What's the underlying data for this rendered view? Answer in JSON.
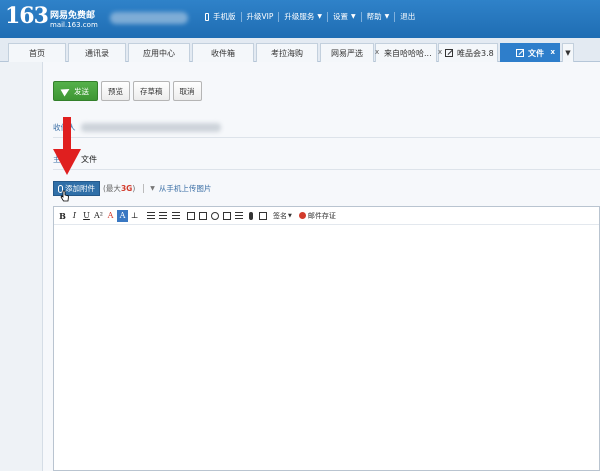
{
  "header": {
    "logo_number": "163",
    "logo_name": "网易免费邮",
    "logo_domain": "mail.163.com",
    "nav": [
      {
        "label": "手机版",
        "icon": "phone-icon"
      },
      {
        "label": "升级VIP"
      },
      {
        "label": "升级服务",
        "dropdown": true
      },
      {
        "label": "设置",
        "dropdown": true
      },
      {
        "label": "帮助",
        "dropdown": true
      },
      {
        "label": "退出"
      }
    ]
  },
  "tabs": [
    {
      "label": "首页"
    },
    {
      "label": "通讯录"
    },
    {
      "label": "应用中心"
    },
    {
      "label": "收件箱"
    },
    {
      "label": "考拉海购"
    },
    {
      "label": "网易严选"
    },
    {
      "label": "来自哈哈哈...",
      "closable": true
    },
    {
      "label": "唯品会3.8",
      "closable": true
    },
    {
      "label": "文件",
      "closable": true,
      "active": true
    }
  ],
  "tab_close_glyph": "x",
  "compose": {
    "send_label": "发送",
    "preview_label": "预览",
    "draft_label": "存草稿",
    "cancel_label": "取消",
    "recipient_label": "收件人",
    "subject_label": "主",
    "subject_value": "文件",
    "add_attachment_label": "添加附件",
    "max_size_prefix": "(最大",
    "max_size_value": "3G",
    "max_size_suffix": ")",
    "mobile_upload_label": "从手机上传图片",
    "signature_label": "签名",
    "seal_label": "邮件存证"
  },
  "format_buttons": [
    "B",
    "I",
    "U",
    "A²",
    "A",
    "A"
  ],
  "colors": {
    "header_blue": "#2f82c9",
    "active_tab": "#2e7ecb",
    "send_green": "#4aa63f",
    "arrow_red": "#e01f1f",
    "max_size_red": "#d23b2c"
  }
}
